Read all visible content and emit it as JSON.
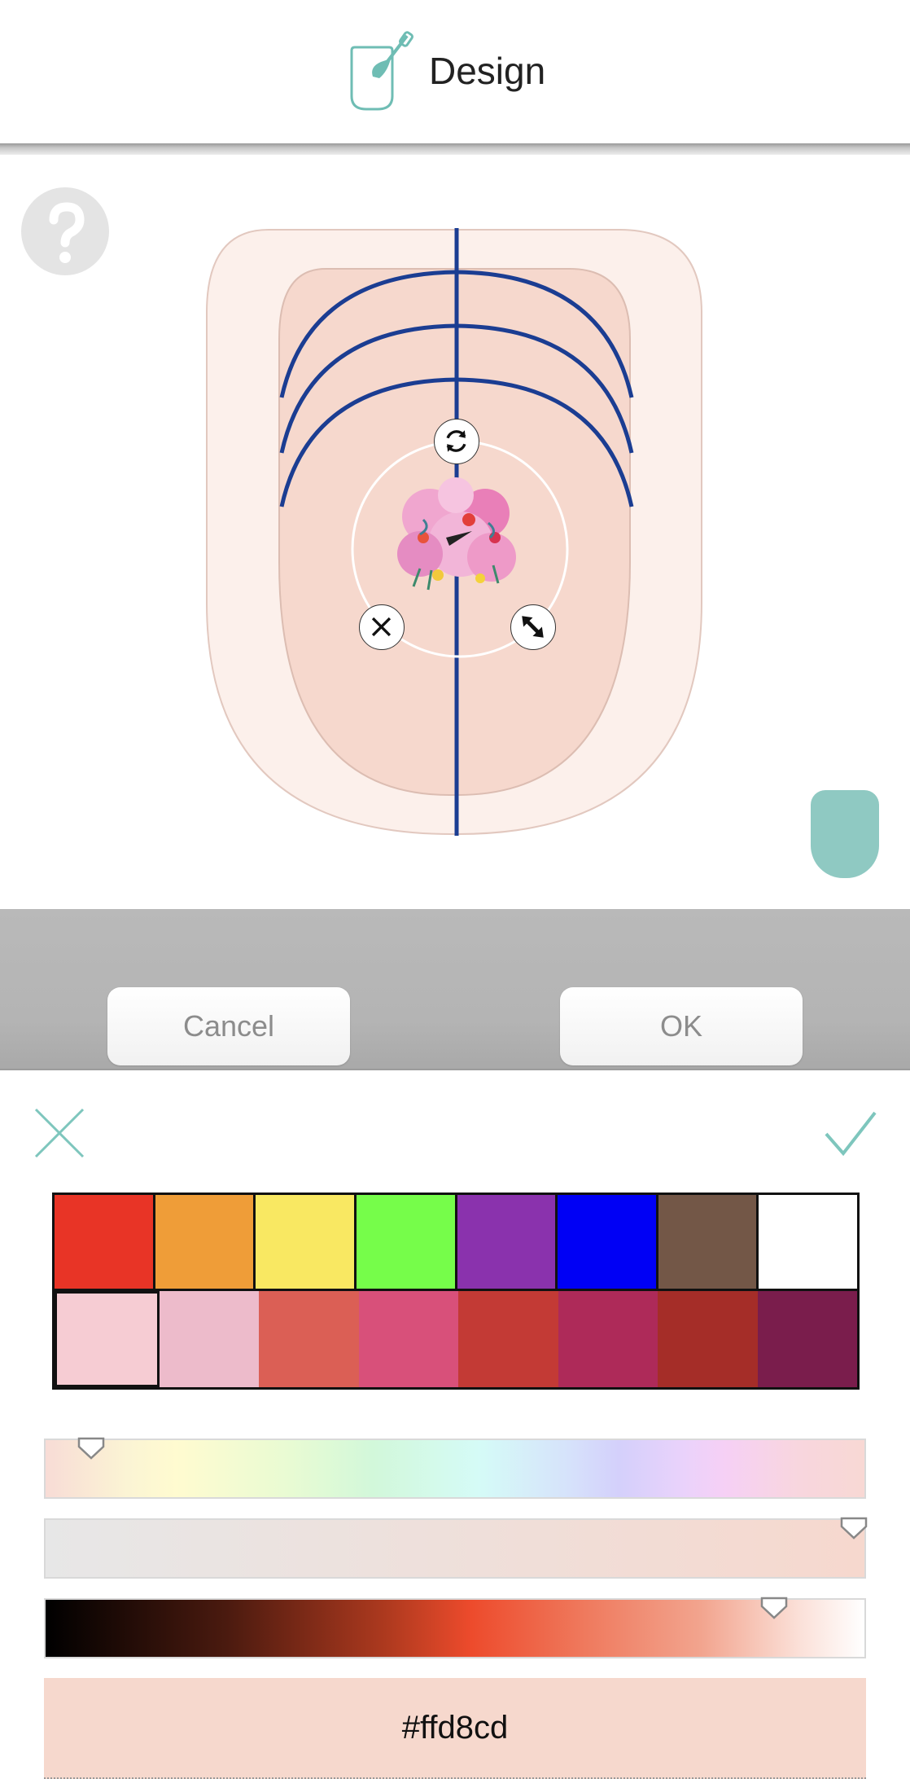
{
  "header": {
    "title": "Design",
    "icon": "nail-brush-icon"
  },
  "canvas": {
    "help_icon": "question-icon",
    "controls": [
      "rotate-icon",
      "delete-icon",
      "resize-icon"
    ],
    "sticker": "flower-bouquet-sticker",
    "nail_color": "#8fc9c2"
  },
  "actions": {
    "cancel_label": "Cancel",
    "ok_label": "OK"
  },
  "picker": {
    "close_icon": "close-icon",
    "confirm_icon": "check-icon",
    "palette_row1": [
      "#e83426",
      "#ef9d38",
      "#f9e862",
      "#76fd4a",
      "#8a32ad",
      "#0000f5",
      "#735747",
      "#ffffff"
    ],
    "palette_row2": [
      "#f6ccd3",
      "#edbbcb",
      "#db5f55",
      "#d8507a",
      "#c33a35",
      "#ae2a59",
      "#a52d28",
      "#7a1d4c"
    ],
    "selected_swatch_index": 8,
    "hue_position": 0.04,
    "saturation_position": 1.0,
    "lightness_position": 0.9,
    "hex_value": "#ffd8cd"
  }
}
